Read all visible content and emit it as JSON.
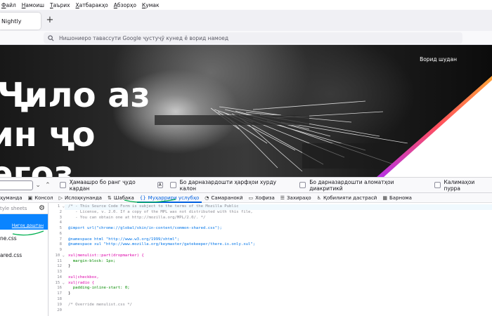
{
  "menubar": {
    "items": [
      {
        "first": "Ф",
        "rest": "айл"
      },
      {
        "first": "Н",
        "rest": "амоиш"
      },
      {
        "first": "Т",
        "rest": "аърих"
      },
      {
        "first": "Х",
        "rest": "атбаракҳо"
      },
      {
        "first": "А",
        "rest": "бзорҳо"
      },
      {
        "first": "К",
        "rest": "умак"
      }
    ]
  },
  "tab": {
    "title": "Nightly"
  },
  "urlbar": {
    "placeholder": "Нишониеро тавассути Google ҷустуҷӯ кунед ё ворид намоед"
  },
  "page": {
    "signin": "Ворид шудан",
    "hero_lines": [
      "Ҷило аз",
      "ин ҷо",
      "егоз"
    ]
  },
  "findbar": {
    "options": [
      "Ҳамаашро бо ранг ҷудо кардан",
      "Бо дарназардошти ҳарфҳои хурду калон",
      "Бо дарназардошти аломатҳои диакритикӣ",
      "Калимаҳои пурра"
    ],
    "highlight_key": "A"
  },
  "devtools": {
    "tabs": [
      {
        "label": "ҳуманда",
        "icon": "",
        "active": false
      },
      {
        "label": "Консол",
        "icon": "▣",
        "active": false
      },
      {
        "label": "Ислоҳкунанда",
        "icon": "▷",
        "active": false
      },
      {
        "label": "Шабака",
        "icon": "⇅",
        "active": false
      },
      {
        "label": "Муҳаррири услубҳо",
        "icon": "{}",
        "active": true
      },
      {
        "label": "Самаранокӣ",
        "icon": "◔",
        "active": false
      },
      {
        "label": "Хофиза",
        "icon": "▭",
        "active": false
      },
      {
        "label": "Захираҳо",
        "icon": "☰",
        "active": false
      },
      {
        "label": "Қобилияти дастрасӣ",
        "icon": "♿",
        "active": false
      },
      {
        "label": "Барнома",
        "icon": "▦",
        "active": false
      }
    ]
  },
  "styleeditor": {
    "filter_placeholder": "tyle sheets",
    "sheets": [
      {
        "name": "",
        "sub": "Нигоҳ доштан",
        "selected": true
      },
      {
        "name": "ne.css",
        "sub": "",
        "selected": false
      },
      {
        "name": "ared.css",
        "sub": "",
        "selected": false
      }
    ],
    "line_numbers": [
      "1",
      "2",
      "3",
      "4",
      "5",
      "6",
      "7",
      "8",
      "9",
      "10",
      "11",
      "12",
      "13",
      "14",
      "15",
      "16",
      "17",
      "18",
      "19",
      "20"
    ],
    "code_lines": [
      "/* - This Source Code Form is subject to the terms of the Mozilla Public",
      "   - License, v. 2.0. If a copy of the MPL was not distributed with this file,",
      "   - You can obtain one at http://mozilla.org/MPL/2.0/. */",
      "",
      "@import url(\"chrome://global/skin/in-content/common-shared.css\");",
      "",
      "@namespace html \"http://www.w3.org/1999/xhtml\";",
      "@namespace xul \"http://www.mozilla.org/keymaster/gatekeeper/there.is.only.xul\";",
      "",
      "xul|menulist::part(dropmarker) {",
      "  margin-block: 1px;",
      "}",
      "",
      "xul|checkbox,",
      "xul|radio {",
      "  padding-inline-start: 0;",
      "}",
      "",
      "/* Override menulist.css */",
      ""
    ]
  },
  "colors": {
    "accent": "#0060df",
    "selection": "#0a84ff",
    "annotation": "#00b050"
  }
}
